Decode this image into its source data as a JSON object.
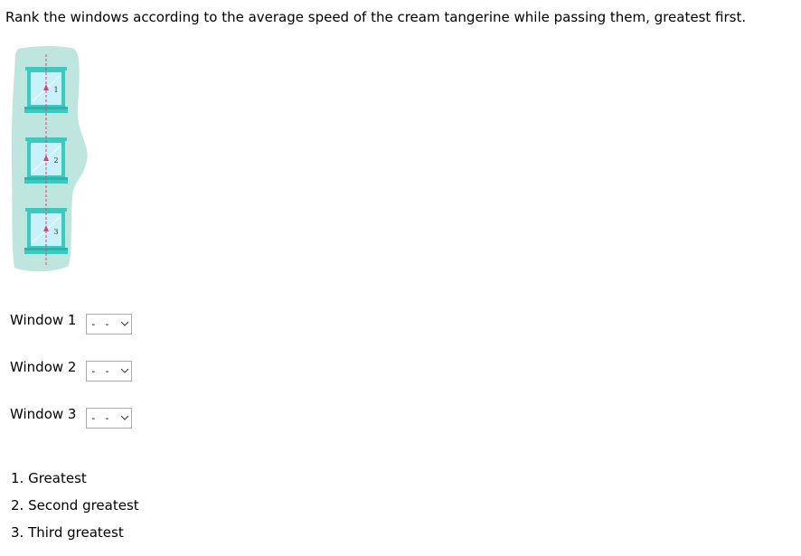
{
  "question": "Rank the windows according to the average speed of the cream tangerine while passing them, greatest first.",
  "figure": {
    "window_numbers": [
      "1",
      "2",
      "3"
    ],
    "colors": {
      "wall": "#bfe6de",
      "frame": "#3cc9c0",
      "glass": "#c9f1fb",
      "path": "#e0407a"
    }
  },
  "rows": [
    {
      "label": "Window 1",
      "selected": "- -"
    },
    {
      "label": "Window 2",
      "selected": "- -"
    },
    {
      "label": "Window 3",
      "selected": "- -"
    }
  ],
  "options": [
    {
      "number": "1.",
      "text": "Greatest"
    },
    {
      "number": "2.",
      "text": "Second greatest"
    },
    {
      "number": "3.",
      "text": "Third greatest"
    }
  ]
}
